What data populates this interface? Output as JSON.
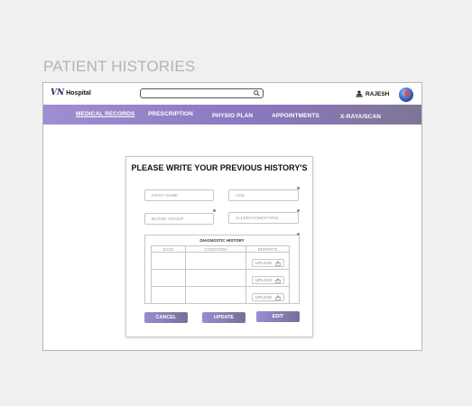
{
  "page": {
    "section_title": "PATIENT HISTORIES"
  },
  "header": {
    "logo_mark": "VN",
    "logo_text": "Hospital",
    "search_placeholder": "",
    "user_name": "RAJESH"
  },
  "nav": {
    "items": [
      {
        "label": "MEDICAL RECORDS",
        "active": true
      },
      {
        "label": "PRESCRIPTION"
      },
      {
        "label": "PHYSIO PLAN"
      },
      {
        "label": "APPOINTMENTS"
      },
      {
        "label": "X-RAYA/SCAN"
      }
    ]
  },
  "form": {
    "title": "PLEASE WRITE YOUR PREVIOUS HISTORY'S",
    "first_name": "FIRST NAME",
    "age": "AGE",
    "blood_group": "BLOOD GROUP",
    "allergy": "ALLERGY(MENTION)",
    "diagnostic": {
      "title": "DIAGNOSTIC HISTORY",
      "columns": [
        "DATE",
        "CONDITION",
        "REPORTS"
      ],
      "upload_label": "UPLOAD"
    },
    "buttons": {
      "cancel": "CANCEL",
      "update": "UPDATE",
      "edit": "EDIT"
    }
  },
  "colors": {
    "nav_start": "#9f8ed0",
    "nav_end": "#7f7596",
    "button": "#8a7cc4"
  }
}
